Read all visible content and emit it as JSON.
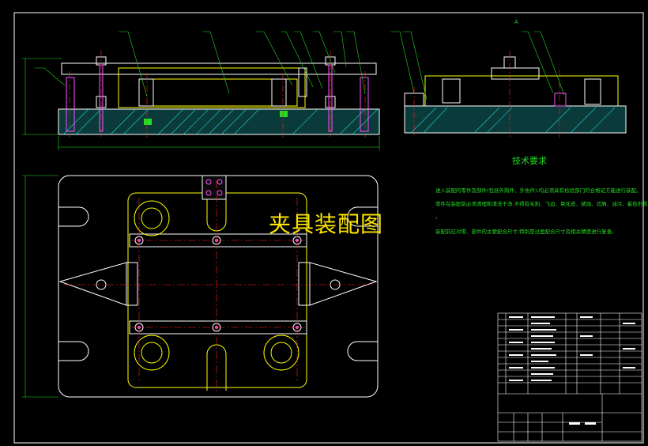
{
  "drawing": {
    "title": "夹具装配图",
    "section_label": "A",
    "tech_requirements": {
      "heading": "技术要求",
      "lines": [
        "进入装配的零件及部件(包括外购件、外协件),均必须具有检验部门的合格证方能进行装配。",
        "零件在装配前必须清理和清洗干净,不得有毛刺、飞边、氧化皮、锈蚀、切屑、油污、着色剂和灰尘等",
        "。",
        "装配前应对零、部件的主要配合尺寸,特别是过盈配合尺寸及相关精度进行复查。"
      ]
    }
  },
  "colors": {
    "background": "#000000",
    "outline": "#ffffff",
    "part": "#ffff00",
    "centerline": "#ff2020",
    "dimension": "#22dd22",
    "hatch": "#20d0d0",
    "bolt": "#ff50ff",
    "title_text": "#ffe600"
  }
}
